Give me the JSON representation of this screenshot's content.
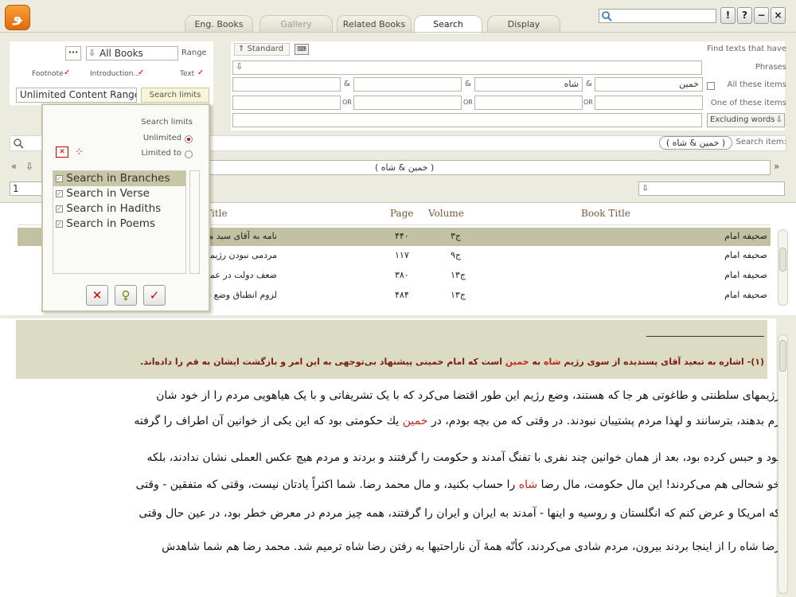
{
  "app": {
    "logo": "ﻮ"
  },
  "tabs": [
    "Eng. Books",
    "Gallery",
    "Related Books",
    "Search",
    "Display"
  ],
  "topbar": {
    "search_value": "",
    "buttons": [
      "!",
      "?",
      "−",
      "×"
    ]
  },
  "left": {
    "more_label": "···",
    "range_value": "All Books",
    "range_label": "Range",
    "footnote_label": "Footnote",
    "introduction_label": "Introduction...",
    "text_label": "Text",
    "limits_value": "Unlimited Content Range",
    "search_limits_button": "Search limits"
  },
  "popup": {
    "title": "Search limits",
    "unlimited": "Unlimited",
    "limited": "Limited to",
    "items": [
      "Search in Branches",
      "Search in Verse",
      "Search in Hadiths",
      "Search in Poems"
    ]
  },
  "right": {
    "standard_button": "Standard",
    "find_label": "Find texts that have",
    "phrases_label": "Phrases",
    "all_items_label": "All these items",
    "one_item_label": "One of these items",
    "excluding_label": "Excluding words",
    "word1": "خمین",
    "word2": "شاه",
    "and": "&",
    "or": "OR",
    "search_item_label": "Search item:",
    "search_item_value": "( خمین & شاه )",
    "query_display": "( خمین & شاه )",
    "page_value": "1"
  },
  "table": {
    "headers": {
      "title": "Title",
      "page": "Page",
      "volume": "Volume",
      "book": "Book Title"
    },
    "rows": [
      {
        "title": "نامه به آقای سید مرتضی پسندیده و با",
        "page": "۴۴۰",
        "volume": "ج۳",
        "book": "صحیفه امام"
      },
      {
        "title": "مردمی نبودن رژیمهای سلطنتی و طاغو",
        "page": "۱۱۷",
        "volume": "ج۹",
        "book": "صحیفه امام"
      },
      {
        "title": "ضعف دولت در عملکرد نامطلوب دستگا",
        "page": "۳۸۰",
        "volume": "ج۱۳",
        "book": "صحیفه امام"
      },
      {
        "title": "لزوم انطباق وضع سفیران و سفارتخانا",
        "page": "۴۸۴",
        "volume": "ج۱۳",
        "book": "صحیفه امام"
      }
    ]
  },
  "footnote": {
    "prefix": "(۱)- اشاره به تبعید آقای پسندیده از سوی رژیم",
    "w1": "شاه",
    "mid1": "به",
    "w2": "خمین",
    "rest": "است که امام خمینی پیشنهاد بی‌توجهی به این امر و بازگشت ایشان به قم را داده‌اند."
  },
  "body": {
    "l1": "رژیمهای سلطنتی و طاغوتی هر جا که هستند، وضع رژیم این طور اقتضا می‌کرد که با یک تشریفاتی و با یک هیاهویی مردم را از خود شان",
    "l2a": "رم بدهند، بترسانند و لهذا مردم پشتیبان نبودند. در وقتی که من بچه بودم، در",
    "l2w": "خمین",
    "l2b": "یك حکومتی بود که این یکی از خوانین آن اطراف را گرفته",
    "l3": "بود و حبس کرده بود، بعد از همان خوانین چند نفری با تفنگ آمدند و حکومت را گرفتند و بردند و مردم هیچ عکس العملی نشان ندادند، بلکه",
    "l4a": "خو شحالی هم می‌کردند! این مال حکومت، مال رضا",
    "l4w": "شاه",
    "l4b": "را حساب بکنید، و مال محمد رضا. شما اکثراً یادتان نیست، وقتی که متفقین - وقتی",
    "l5": "که امریکا و عرض کنم که انگلستان و روسیه و اینها - آمدند به ایران و ایران را گرفتند، همه چیز مردم در معرض خطر بود، در عین حال وقتی",
    "l6": "رضا شاه را از اینجا بردند بیرون، مردم شادی می‌کردند، کأنّه همهٔ آن ناراحتیها به رفتن رضا شاه ترمیم شد. محمد رضا هم شما شاهدش"
  }
}
